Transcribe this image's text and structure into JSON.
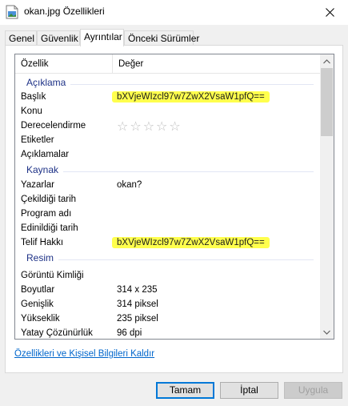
{
  "window": {
    "title": "okan.jpg Özellikleri",
    "close_glyph": "✕"
  },
  "tabs": [
    {
      "label": "Genel"
    },
    {
      "label": "Güvenlik"
    },
    {
      "label": "Ayrıntılar"
    },
    {
      "label": "Önceki Sürümler"
    }
  ],
  "active_tab": "Ayrıntılar",
  "list": {
    "columns": {
      "property": "Özellik",
      "value": "Değer"
    },
    "groups": {
      "description": "Açıklama",
      "origin": "Kaynak",
      "image": "Resim"
    },
    "rows": {
      "title": {
        "prop": "Başlık",
        "val": "bXVjeWIzcl97w7ZwX2VsaW1pfQ=="
      },
      "subject": {
        "prop": "Konu",
        "val": ""
      },
      "rating": {
        "prop": "Derecelendirme",
        "val": "☆☆☆☆☆"
      },
      "tags": {
        "prop": "Etiketler",
        "val": ""
      },
      "comments": {
        "prop": "Açıklamalar",
        "val": ""
      },
      "authors": {
        "prop": "Yazarlar",
        "val": "okan?"
      },
      "date_taken": {
        "prop": "Çekildiği tarih",
        "val": ""
      },
      "program": {
        "prop": "Program adı",
        "val": ""
      },
      "date_acquired": {
        "prop": "Edinildiği tarih",
        "val": ""
      },
      "copyright": {
        "prop": "Telif Hakkı",
        "val": "bXVjeWIzcl97w7ZwX2VsaW1pfQ=="
      },
      "image_id": {
        "prop": "Görüntü Kimliği",
        "val": ""
      },
      "dimensions": {
        "prop": "Boyutlar",
        "val": "314 x 235"
      },
      "width": {
        "prop": "Genişlik",
        "val": "314 piksel"
      },
      "height": {
        "prop": "Yükseklik",
        "val": "235 piksel"
      },
      "h_resolution": {
        "prop": "Yatay Çözünürlük",
        "val": "96 dpi"
      }
    }
  },
  "highlight_color": "#ffff4d",
  "remove_link": "Özellikleri ve Kişisel Bilgileri Kaldır",
  "buttons": {
    "ok": "Tamam",
    "cancel": "İptal",
    "apply": "Uygula"
  }
}
